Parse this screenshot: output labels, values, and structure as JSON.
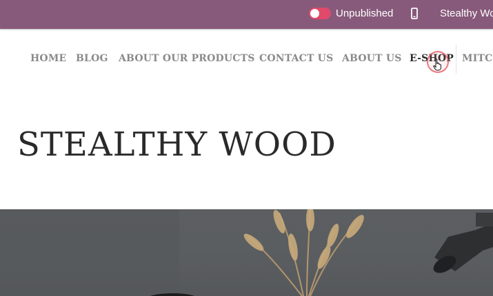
{
  "admin_bar": {
    "publish_toggle_label": "Unpublished",
    "site_name": "Stealthy Wo",
    "colors": {
      "bar": "#875A7B",
      "toggle": "#E0496A"
    },
    "icons": [
      "toggle-switch",
      "mobile-phone-icon"
    ]
  },
  "nav": {
    "items": [
      {
        "label": "Home"
      },
      {
        "label": "Blog"
      },
      {
        "label": "About our products"
      },
      {
        "label": "Contact us"
      },
      {
        "label": "About us"
      },
      {
        "label": "E-shop",
        "active": true
      },
      {
        "label": "Mitc"
      }
    ]
  },
  "page": {
    "title": "STEALTHY WOOD"
  }
}
